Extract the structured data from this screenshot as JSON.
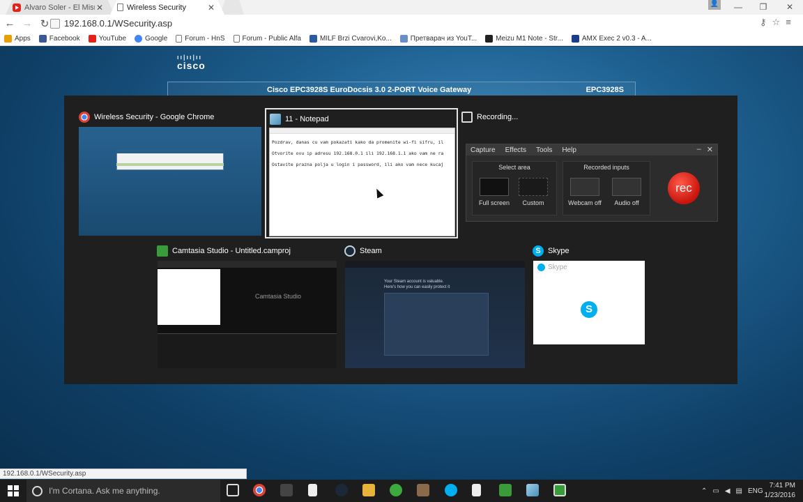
{
  "tabs": [
    {
      "title": "Alvaro Soler - El Mismo",
      "icon": "youtube-icon",
      "close": "✕"
    },
    {
      "title": "Wireless Security",
      "icon": "page-icon",
      "close": "✕"
    }
  ],
  "window_controls": {
    "minimize": "—",
    "maximize": "❐",
    "close": "✕"
  },
  "toolbar": {
    "back": "←",
    "forward": "→",
    "reload": "↻",
    "url": "192.168.0.1/WSecurity.asp"
  },
  "bookmarks": [
    {
      "label": "Apps",
      "icon": "apps-grid-icon",
      "color": "#e8a000"
    },
    {
      "label": "Facebook",
      "icon": "facebook-icon",
      "color": "#3b5998"
    },
    {
      "label": "YouTube",
      "icon": "youtube-icon",
      "color": "#e62117"
    },
    {
      "label": "Google",
      "icon": "google-icon",
      "color": "#4285f4"
    },
    {
      "label": "Forum - HnS",
      "icon": "page-icon",
      "color": "#ffffff"
    },
    {
      "label": "Forum - Public Alfa",
      "icon": "page-icon",
      "color": "#ffffff"
    },
    {
      "label": "MILF Brzi Cvarovi,Ko...",
      "icon": "bookmark-icon",
      "color": "#2c5aa0"
    },
    {
      "label": "Претварач из YouT...",
      "icon": "converter-icon",
      "color": "#6a8fc7"
    },
    {
      "label": "Meizu M1 Note - Str...",
      "icon": "arrow-icon",
      "color": "#222222"
    },
    {
      "label": "AMX Exec 2 v0.3 - A...",
      "icon": "amx-icon",
      "color": "#1a3e8a"
    }
  ],
  "router": {
    "brand": "cisco",
    "bars": "ıı|ıı|ıı",
    "title": "Cisco EPC3928S EuroDocsis 3.0 2-PORT Voice Gateway",
    "model": "EPC3928S"
  },
  "switcher": {
    "chrome": {
      "title": "Wireless Security - Google Chrome"
    },
    "notepad": {
      "title": "11 - Notepad",
      "lines": [
        "Pozdrav, danas cu vam pokazati kako da promenite wi-fi sifru, il",
        "Otvorite ovu ip adresu 192.168.0.1 ili 192.168.1.1 ako vam ne ra",
        "Ostavite prazna polja u login i password, ili ako vam nece kucaj"
      ]
    },
    "recorder": {
      "title": "Recording...",
      "menu": [
        "Capture",
        "Effects",
        "Tools",
        "Help"
      ],
      "select_area": "Select area",
      "recorded_inputs": "Recorded inputs",
      "fullscreen": "Full screen",
      "custom": "Custom",
      "webcam": "Webcam off",
      "audio": "Audio off",
      "rec": "rec"
    },
    "camtasia": {
      "title": "Camtasia Studio - Untitled.camproj",
      "logo": "Camtasia Studio"
    },
    "steam": {
      "title": "Steam",
      "headline": "Your Steam account is valuable.",
      "sub": "Here's how you can easily protect it"
    },
    "skype": {
      "title": "Skype",
      "inner": "Skype"
    }
  },
  "status_url": "192.168.0.1/WSecurity.asp",
  "taskbar": {
    "cortana": "I'm Cortana. Ask me anything.",
    "lang": "ENG",
    "time": "7:41 PM",
    "date": "1/23/2016"
  },
  "colors": {
    "accent": "#1d5f8f",
    "rec": "#c8140c",
    "skype": "#00aff0"
  }
}
